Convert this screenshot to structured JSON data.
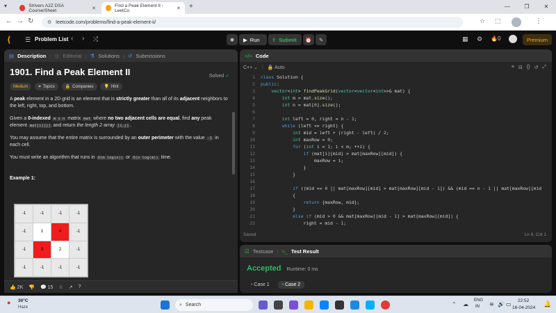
{
  "browser": {
    "tabs": [
      {
        "title": "Strivers A2Z DSA Course/Sheet",
        "active": false
      },
      {
        "title": "Find a Peak Element II - LeetCo",
        "active": true
      }
    ],
    "url": "leetcode.com/problems/find-a-peak-element-ii/"
  },
  "lcnav": {
    "problem_list": "Problem List",
    "run": "Run",
    "submit": "Submit",
    "streak": "0",
    "premium": "Premium"
  },
  "left_tabs": {
    "description": "Description",
    "editorial": "Editorial",
    "solutions": "Solutions",
    "submissions": "Submissions"
  },
  "problem": {
    "title": "1901. Find a Peak Element II",
    "status": "Solved",
    "difficulty": "Medium",
    "topics": "Topics",
    "companies": "Companies",
    "hint": "Hint",
    "p1_a": "A ",
    "p1_b": "peak",
    "p1_c": " element in a 2D grid is an element that is ",
    "p1_d": "strictly greater",
    "p1_e": " than all of its ",
    "p1_f": "adjacent",
    "p1_g": " neighbors to the left, right, top, and bottom.",
    "p2_a": "Given a ",
    "p2_b": "0-indexed",
    "p2_c": "m x n",
    "p2_d": " matrix ",
    "p2_e": "mat",
    "p2_f": " where ",
    "p2_g": "no two adjacent cells are equal",
    "p2_h": ", find ",
    "p2_i": "any",
    "p2_j": " peak element ",
    "p2_k": "mat[i][j]",
    "p2_l": " and return ",
    "p2_m": "the length 2 array",
    "p2_n": "[i,j]",
    "p3_a": "You may assume that the entire matrix is surrounded by an ",
    "p3_b": "outer perimeter",
    "p3_c": " with the value ",
    "p3_d": "-1",
    "p3_e": " in each cell.",
    "p4_a": "You must write an algorithm that runs in ",
    "p4_b": "O(m log(n))",
    "p4_c": " or ",
    "p4_d": "O(n log(m))",
    "p4_e": " time.",
    "example": "Example 1:",
    "grid": [
      [
        "-1",
        "-1",
        "-1",
        "-1"
      ],
      [
        "-1",
        "1",
        "4",
        "-1"
      ],
      [
        "-1",
        "3",
        "2",
        "-1"
      ],
      [
        "-1",
        "-1",
        "-1",
        "-1"
      ]
    ],
    "likes": "2K",
    "comments": "15"
  },
  "code_panel": {
    "title": "Code",
    "language": "C++",
    "mode": "Auto",
    "status": "Saved",
    "cursor": "Ln 6, Col 1",
    "lines": [
      {
        "n": "1",
        "t": "class Solution {"
      },
      {
        "n": "2",
        "t": "public:"
      },
      {
        "n": "3",
        "t": "    vector<int> findPeakGrid(vector<vector<int>>& mat) {"
      },
      {
        "n": "4",
        "t": "        int m = mat.size();"
      },
      {
        "n": "5",
        "t": "        int n = mat[0].size();"
      },
      {
        "n": "6",
        "t": ""
      },
      {
        "n": "7",
        "t": "        int left = 0, right = n - 1;"
      },
      {
        "n": "8",
        "t": "        while (left <= right) {"
      },
      {
        "n": "9",
        "t": "            int mid = left + (right - left) / 2;"
      },
      {
        "n": "10",
        "t": "            int maxRow = 0;"
      },
      {
        "n": "11",
        "t": "            for (int i = 1; i < m; ++i) {"
      },
      {
        "n": "12",
        "t": "                if (mat[i][mid] > mat[maxRow][mid]) {"
      },
      {
        "n": "13",
        "t": "                    maxRow = i;"
      },
      {
        "n": "14",
        "t": "                }"
      },
      {
        "n": "15",
        "t": "            }"
      },
      {
        "n": "16",
        "t": ""
      },
      {
        "n": "17",
        "t": "            if ((mid == 0 || mat[maxRow][mid] > mat[maxRow][mid - 1]) && (mid == n - 1 || mat[maxRow][mid"
      },
      {
        "n": "18",
        "t": "            {"
      },
      {
        "n": "19",
        "t": "                return {maxRow, mid};"
      },
      {
        "n": "20",
        "t": "            }"
      },
      {
        "n": "21",
        "t": "            else if (mid > 0 && mat[maxRow][mid - 1] > mat[maxRow][mid]) {"
      },
      {
        "n": "22",
        "t": "                right = mid - 1;"
      }
    ]
  },
  "test_panel": {
    "testcase": "Testcase",
    "result": "Test Result",
    "accepted": "Accepted",
    "runtime": "Runtime: 0 ms",
    "case1": "Case 1",
    "case2": "Case 2"
  },
  "taskbar": {
    "weather_temp": "30°C",
    "weather_desc": "Haze",
    "search": "Search",
    "lang1": "ENG",
    "lang2": "IN",
    "time": "22:52",
    "date": "16-04-2024"
  }
}
